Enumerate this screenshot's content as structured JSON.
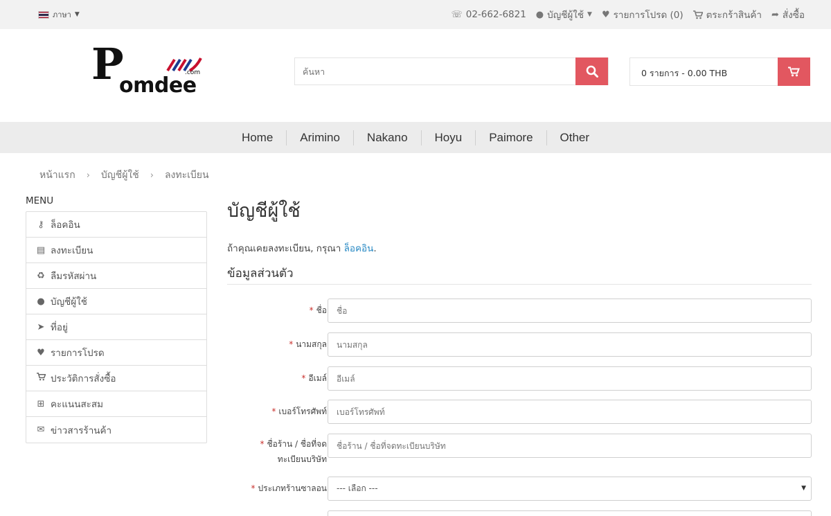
{
  "topbar": {
    "language": "ภาษา",
    "phone": "02-662-6821",
    "account": "บัญชีผู้ใช้",
    "wishlist": "รายการโปรด (0)",
    "cart": "ตระกร้าสินค้า",
    "checkout": "สั่งซื้อ"
  },
  "logo": {
    "text": "omdee",
    "initial": "P",
    "suffix": ".com"
  },
  "search": {
    "placeholder": "ค้นหา"
  },
  "cart": {
    "summary": "0 รายการ - 0.00 THB"
  },
  "nav": [
    "Home",
    "Arimino",
    "Nakano",
    "Hoyu",
    "Paimore",
    "Other"
  ],
  "breadcrumb": [
    "หน้าแรก",
    "บัญชีผู้ใช้",
    "ลงทะเบียน"
  ],
  "sidebar": {
    "title": "MENU",
    "items": [
      {
        "label": "ล็อคอิน",
        "icon": "key-icon"
      },
      {
        "label": "ลงทะเบียน",
        "icon": "id-card-icon"
      },
      {
        "label": "ลืมรหัสผ่าน",
        "icon": "recycle-icon"
      },
      {
        "label": "บัญชีผู้ใช้",
        "icon": "user-icon"
      },
      {
        "label": "ที่อยู่",
        "icon": "location-arrow-icon"
      },
      {
        "label": "รายการโปรด",
        "icon": "heart-icon"
      },
      {
        "label": "ประวัติการสั่งซื้อ",
        "icon": "cart-icon"
      },
      {
        "label": "คะแนนสะสม",
        "icon": "gift-icon"
      },
      {
        "label": "ข่าวสารร้านค้า",
        "icon": "envelope-icon"
      }
    ]
  },
  "main": {
    "title": "บัญชีผู้ใช้",
    "intro_text": "ถ้าคุณเคยลงทะเบียน, กรุณา ",
    "intro_link": "ล็อคอิน",
    "intro_end": ".",
    "section": "ข้อมูลส่วนตัว",
    "fields": [
      {
        "label": "ชื่อ",
        "placeholder": "ชื่อ"
      },
      {
        "label": "นามสกุล",
        "placeholder": "นามสกุล"
      },
      {
        "label": "อีเมล์",
        "placeholder": "อีเมล์"
      },
      {
        "label": "เบอร์โทรศัพท์",
        "placeholder": "เบอร์โทรศัพท์"
      },
      {
        "label": "ชื่อร้าน / ชื่อที่จด",
        "label2": "ทะเบียนบริษัท",
        "placeholder": "ชื่อร้าน / ชื่อที่จดทะเบียนบริษัท"
      }
    ],
    "salon_type": {
      "label": "ประเภทร้านซาลอน",
      "selected": "--- เลือก ---"
    }
  },
  "colors": {
    "accent": "#e25760",
    "link": "#2a8ac4",
    "required": "#c9302c"
  }
}
